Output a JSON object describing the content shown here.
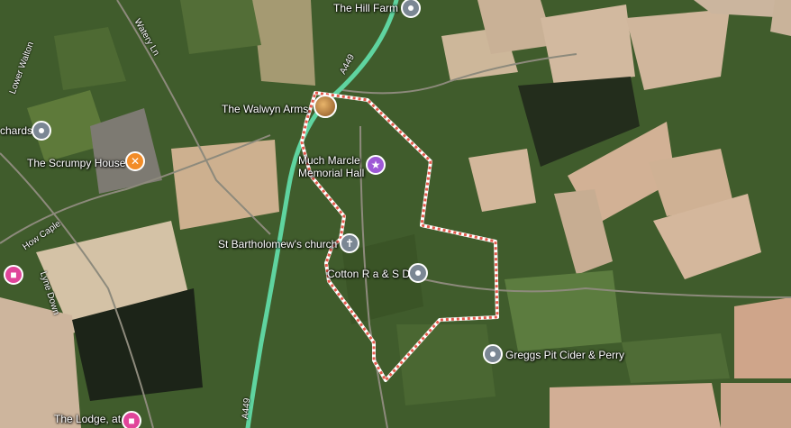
{
  "map": {
    "places": {
      "hill_farm": "The Hill Farm",
      "walwyn_arms": "The Walwyn Arms",
      "orchards": "chards",
      "scrumpy_house": "The Scrumpy House",
      "much_marcle_line1": "Much Marcle",
      "much_marcle_line2": "Memorial Hall",
      "st_bartholomews": "St Bartholomew's church",
      "cotton": "Cotton R a & S D",
      "greggs_pit": "Greggs Pit Cider & Perry",
      "the_lodge": "The Lodge, at"
    },
    "roads": {
      "a449_top": "A449",
      "a449_bottom": "A449",
      "watery_ln": "Watery Ln",
      "how_caple": "How Caple",
      "lyne_down": "Lyne Down",
      "lower_walton": "Lower Walton"
    },
    "colors": {
      "highway": "#5fd4a0",
      "boundary": "#e45a4c",
      "grey_pin": "#7b8794",
      "food_pin": "#f28c28",
      "venue_pin": "#9e59d6",
      "lodging_pin": "#e0459a"
    },
    "icons": {
      "hill_farm": "pin-dot-icon",
      "orchards": "pin-dot-icon",
      "scrumpy_house": "restaurant-icon",
      "much_marcle": "event-venue-icon",
      "st_bartholomews": "church-icon",
      "cotton": "pin-dot-icon",
      "greggs_pit": "pin-dot-icon",
      "the_lodge": "hotel-icon",
      "walwyn_arms": "photo-marker"
    }
  }
}
